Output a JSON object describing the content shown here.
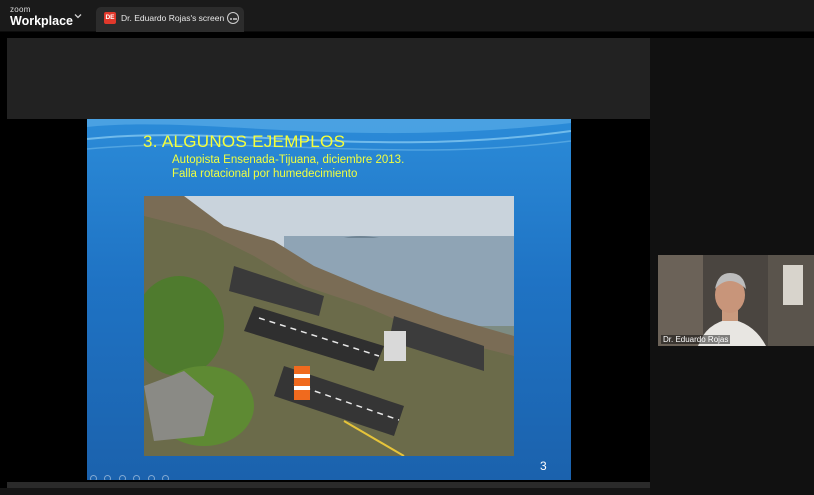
{
  "app": {
    "logo_small": "zoom",
    "logo_big": "Workplace",
    "menu_icon": "chevron-down-icon"
  },
  "tab": {
    "avatar_initials": "DE",
    "title": "Dr. Eduardo Rojas's screen",
    "more_icon": "more-options-icon"
  },
  "slide": {
    "heading": "3. ALGUNOS EJEMPLOS",
    "subtitle_line1": "Autopista Ensenada-Tijuana, diciembre 2013.",
    "subtitle_line2": "Falla rotacional por humedecimiento",
    "page_number": "3"
  },
  "participant": {
    "name": "Dr. Eduardo Rojas"
  },
  "colors": {
    "accent_red": "#e0382b",
    "slide_text_yellow": "#f0ff40",
    "slide_blue": "#1f73c4"
  }
}
